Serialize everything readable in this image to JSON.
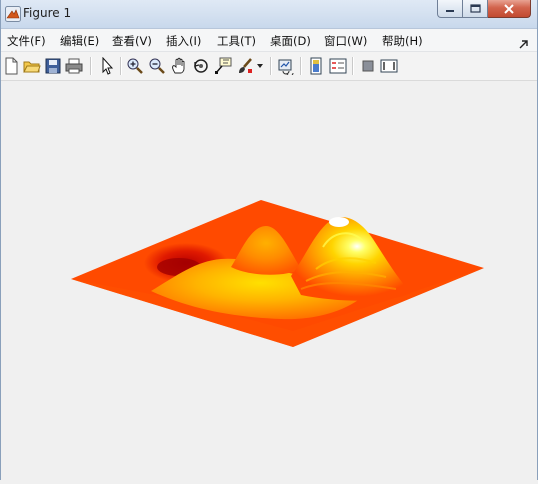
{
  "window": {
    "title": "Figure 1",
    "controls": {
      "minimize": "minimize",
      "maximize": "maximize",
      "close": "close"
    }
  },
  "menubar": {
    "items": [
      {
        "label": "文件(F)"
      },
      {
        "label": "编辑(E)"
      },
      {
        "label": "查看(V)"
      },
      {
        "label": "插入(I)"
      },
      {
        "label": "工具(T)"
      },
      {
        "label": "桌面(D)"
      },
      {
        "label": "窗口(W)"
      },
      {
        "label": "帮助(H)"
      }
    ]
  },
  "toolbar": {
    "buttons": [
      {
        "icon": "new-figure-icon"
      },
      {
        "icon": "open-file-icon"
      },
      {
        "icon": "save-icon"
      },
      {
        "icon": "print-icon"
      },
      {
        "icon": "edit-plot-arrow-icon"
      },
      {
        "icon": "zoom-in-icon"
      },
      {
        "icon": "zoom-out-icon"
      },
      {
        "icon": "pan-hand-icon"
      },
      {
        "icon": "rotate-3d-icon"
      },
      {
        "icon": "data-cursor-icon"
      },
      {
        "icon": "brush-icon"
      },
      {
        "icon": "link-plot-icon"
      },
      {
        "icon": "insert-colorbar-icon"
      },
      {
        "icon": "insert-legend-icon"
      },
      {
        "icon": "hide-plot-tools-icon"
      },
      {
        "icon": "show-plot-tools-icon"
      }
    ]
  },
  "figure": {
    "plot_type": "surface",
    "description_colors": {
      "base": "#ff4400",
      "mid": "#ff8800",
      "high": "#ffdd00",
      "peak": "#ffffff",
      "well": "#c00000"
    },
    "axes_visible": false
  }
}
